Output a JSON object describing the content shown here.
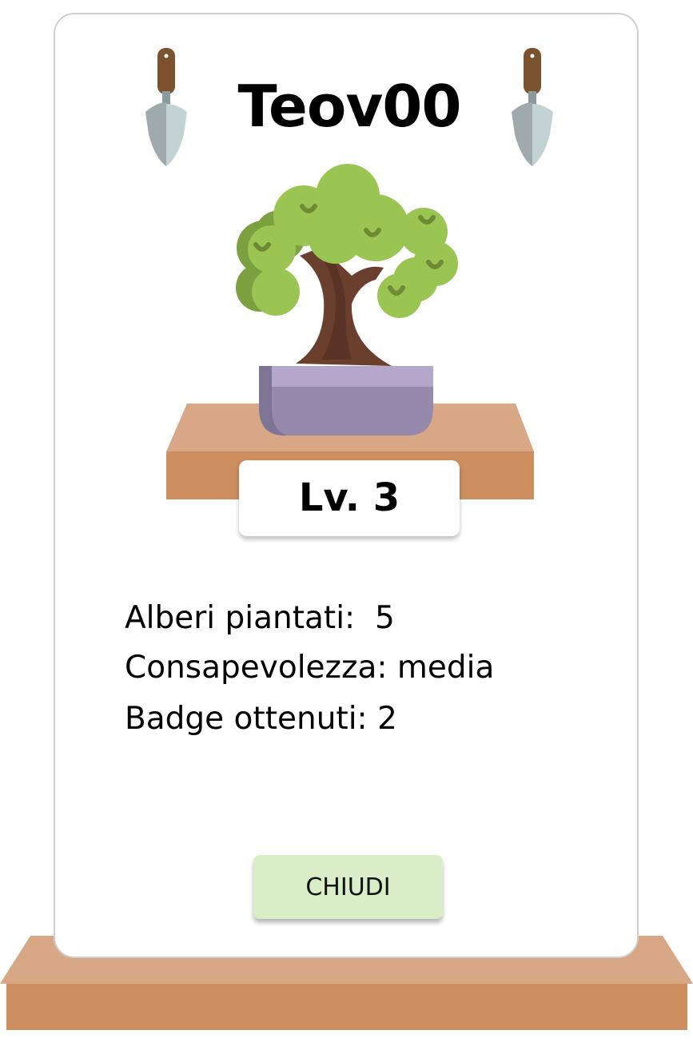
{
  "profile": {
    "username": "Teov00",
    "level": "Lv. 3"
  },
  "stats": {
    "trees_planted": "Alberi piantati:  5",
    "awareness": "Consapevolezza: media",
    "badges": "Badge ottenuti: 2"
  },
  "actions": {
    "close_label": "CHIUDI"
  },
  "icons": {
    "left": "trowel-icon",
    "right": "trowel-icon",
    "main": "bonsai-icon"
  },
  "colors": {
    "wood_light": "#d8a886",
    "wood_dark": "#cc8e5f",
    "leaf": "#9ac552",
    "pot": "#958aac",
    "button_bg": "#d9edc8"
  }
}
